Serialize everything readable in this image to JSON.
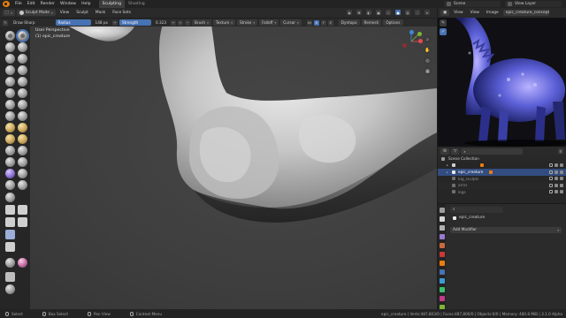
{
  "menu": {
    "items": [
      "File",
      "Edit",
      "Render",
      "Window",
      "Help"
    ],
    "workspaces": [
      "Sculpting",
      "Shading"
    ],
    "active_workspace": "Sculpting"
  },
  "top_right": {
    "scene": "Scene",
    "view_layer": "View Layer"
  },
  "viewport_header": {
    "mode": "Sculpt Mode",
    "menus": [
      "View",
      "Sculpt",
      "Mask",
      "Face Sets"
    ]
  },
  "tool_header": {
    "brush_name": "Draw Sharp",
    "radius_label": "Radius",
    "radius_value": "148 px",
    "strength_label": "Strength",
    "strength_value": "0.323",
    "dropdowns": [
      "Brush",
      "Texture",
      "Stroke",
      "Falloff",
      "Cursor"
    ],
    "axes": [
      "X",
      "Y",
      "Z"
    ],
    "right_dropdowns": [
      "Dyntopo",
      "Remesh",
      "Options"
    ]
  },
  "viewport": {
    "perspective": "User Perspective",
    "object": "(1) epic_creature"
  },
  "gizmo": {
    "axes": [
      "X",
      "Y",
      "Z"
    ]
  },
  "image_editor": {
    "menus": [
      "View",
      "View",
      "Image"
    ],
    "image_name": "epic_creature_concept"
  },
  "outliner": {
    "rows": [
      {
        "name": "Scene Collection",
        "level": 0
      },
      {
        "name": "",
        "level": 1
      },
      {
        "name": "epic_creature",
        "level": 1
      },
      {
        "name": "big_sculpts",
        "level": 1
      },
      {
        "name": "arms",
        "level": 1
      },
      {
        "name": "legs",
        "level": 1
      }
    ]
  },
  "properties": {
    "object_name": "epic_creature",
    "add_modifier": "Add Modifier"
  },
  "statusbar": {
    "select": "Select",
    "box_select": "Box Select",
    "pan": "Pan View",
    "context": "Context Menu",
    "stats": "epic_creature | Verts:487,803/0 | Faces:487,800/0 | Objects:0/0 | Memory: 480.8 MiB | 3.1.0 Alpha"
  },
  "colors": {
    "accent": "#4772b3",
    "blender_orange": "#e87d0d",
    "x_axis": "#e8484f",
    "y_axis": "#7eb436",
    "z_axis": "#3f88d6"
  }
}
